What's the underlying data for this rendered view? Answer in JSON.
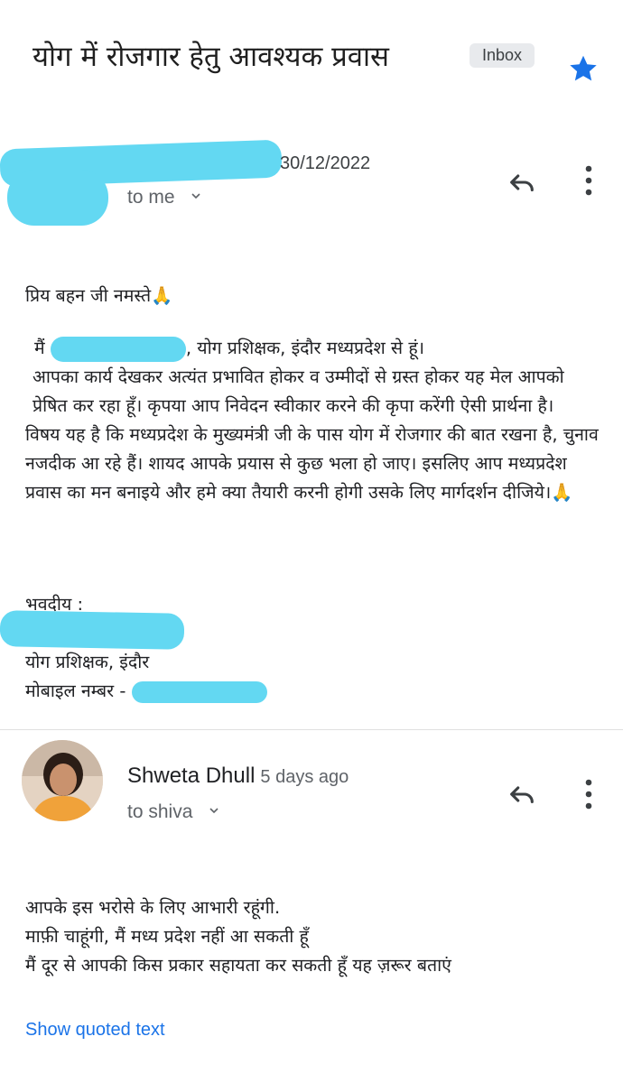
{
  "email": {
    "subject": "योग में रोजगार हेतु आवश्यक प्रवास",
    "label": "Inbox",
    "icons": {
      "star": "star-icon",
      "reply": "reply-icon",
      "more": "more-vert-icon",
      "chevron": "chevron-down-icon"
    },
    "accent_star": "#1a73e8",
    "link_color": "#1a73e8"
  },
  "message1": {
    "date": "30/12/2022",
    "recipient": "to me",
    "greeting": "प्रिय बहन जी नमस्ते🙏",
    "intro_prefix": "मैं ",
    "intro_suffix": ", योग प्रशिक्षक, इंदौर मध्यप्रदेश से हूं।",
    "para1": "आपका कार्य देखकर अत्यंत प्रभावित होकर व उम्मीदों से ग्रस्त होकर यह मेल आपको प्रेषित कर रहा हूँ। कृपया आप निवेदन स्वीकार करने की कृपा करेंगी ऐसी प्रार्थना है।",
    "para2": "विषय यह है कि मध्यप्रदेश के मुख्यमंत्री जी के पास योग में रोजगार की बात रखना है, चुनाव नजदीक आ रहे हैं। शायद आपके प्रयास से कुछ भला हो जाए। इसलिए आप मध्यप्रदेश प्रवास का मन बनाइये और हमे क्या तैयारी करनी होगी उसके लिए मार्गदर्शन दीजिये।🙏",
    "closing": "भवदीय :",
    "sig_title": "योग प्रशिक्षक, इंदौर",
    "sig_mobile": "मोबाइल नम्बर - "
  },
  "message2": {
    "sender": "Shweta Dhull",
    "time_ago": "5 days ago",
    "recipient": "to shiva",
    "line1": "आपके इस भरोसे के लिए आभारी रहूंगी.",
    "line2": "माफ़ी चाहूंगी, मैं मध्य प्रदेश नहीं आ सकती हूँ",
    "line3": "मैं दूर से आपकी किस प्रकार सहायता कर सकती हूँ यह ज़रूर बताएं",
    "show_quoted": "Show quoted text"
  }
}
